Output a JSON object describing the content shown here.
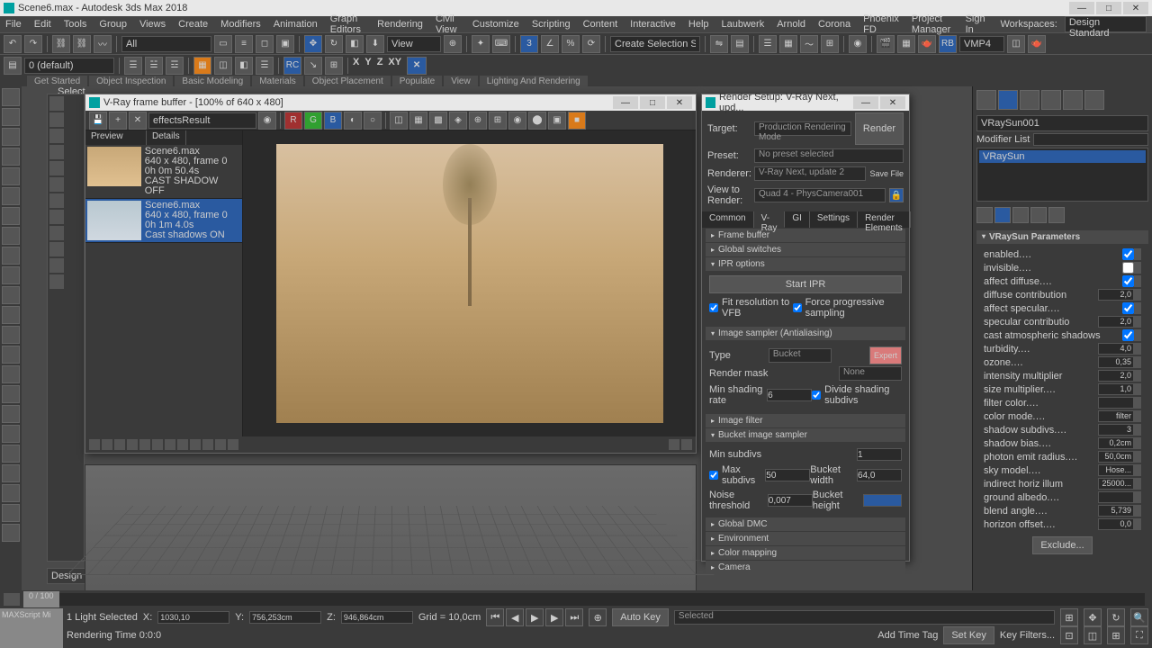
{
  "app": {
    "title": "Scene6.max - Autodesk 3ds Max 2018",
    "signin": "Sign In",
    "workspace_label": "Workspaces:",
    "workspace_value": "Design Standard"
  },
  "menubar": [
    "File",
    "Edit",
    "Tools",
    "Group",
    "Views",
    "Create",
    "Modifiers",
    "Animation",
    "Graph Editors",
    "Rendering",
    "Civil View",
    "Customize",
    "Scripting",
    "Content",
    "Interactive",
    "Help",
    "Laubwerk",
    "Arnold",
    "Corona",
    "Phoenix FD",
    "Project Manager"
  ],
  "ribbon_tabs": [
    "Get Started",
    "Object Inspection",
    "Basic Modeling",
    "Materials",
    "Object Placement",
    "Populate",
    "View",
    "Lighting And Rendering"
  ],
  "toolbar": {
    "dropdown1": "All",
    "ref_coord": "View",
    "selection_set": "Create Selection Se",
    "vmp": "VMP4"
  },
  "layer_bar": {
    "layer": "0 (default)"
  },
  "select_label": "Select",
  "vfb": {
    "title": "V-Ray frame buffer - [100% of 640 x 480]",
    "channel": "effectsResult",
    "history": {
      "col_preview": "Preview",
      "col_details": "Details",
      "items": [
        {
          "file": "Scene6.max",
          "res": "640 x 480, frame 0",
          "time": "0h 0m 50.4s",
          "note": "CAST SHADOW OFF"
        },
        {
          "file": "Scene6.max",
          "res": "640 x 480, frame 0",
          "time": "0h 1m 4.0s",
          "note": "Cast shadows ON"
        }
      ]
    }
  },
  "render_setup": {
    "title": "Render Setup: V-Ray Next, upd...",
    "target_label": "Target:",
    "target_value": "Production Rendering Mode",
    "preset_label": "Preset:",
    "preset_value": "No preset selected",
    "renderer_label": "Renderer:",
    "renderer_value": "V-Ray Next, update 2",
    "view_label": "View to Render:",
    "view_value": "Quad 4 - PhysCamera001",
    "render_btn": "Render",
    "save_btn": "Save File",
    "tabs": [
      "Common",
      "V-Ray",
      "GI",
      "Settings",
      "Render Elements"
    ],
    "rollouts": {
      "frame_buffer": "Frame buffer",
      "global_switches": "Global switches",
      "ipr_options": "IPR options",
      "image_sampler": "Image sampler (Antialiasing)",
      "image_filter": "Image filter",
      "bucket_sampler": "Bucket image sampler",
      "global_dmc": "Global DMC",
      "environment": "Environment",
      "color_mapping": "Color mapping",
      "camera": "Camera"
    },
    "ipr": {
      "start_btn": "Start IPR",
      "fit_res": "Fit resolution to VFB",
      "force_prog": "Force progressive sampling"
    },
    "sampler": {
      "type_label": "Type",
      "type_value": "Bucket",
      "expert_btn": "Expert",
      "mask_label": "Render mask",
      "mask_value": "None",
      "shade_label": "Min shading rate",
      "shade_value": "6",
      "divide": "Divide shading subdivs"
    },
    "bucket": {
      "min_label": "Min subdivs",
      "min_value": "1",
      "max_label": "Max subdivs",
      "max_value": "50",
      "noise_label": "Noise threshold",
      "noise_value": "0,007",
      "bw_label": "Bucket width",
      "bw_value": "64,0",
      "bh_label": "Bucket height"
    }
  },
  "modifier_panel": {
    "object_name": "VRaySun001",
    "modifier_list_label": "Modifier List",
    "stack_item": "VRaySun",
    "rollout_title": "VRaySun Parameters",
    "params": [
      {
        "name": "enabled",
        "val": "",
        "check": true
      },
      {
        "name": "invisible",
        "val": "",
        "check": false
      },
      {
        "name": "affect diffuse",
        "val": "",
        "check": true
      },
      {
        "name": "diffuse contribution",
        "val": "2,0"
      },
      {
        "name": "affect specular",
        "val": "",
        "check": true
      },
      {
        "name": "specular contributio",
        "val": "2,0"
      },
      {
        "name": "cast atmospheric shadows",
        "val": "",
        "check": true
      },
      {
        "name": "turbidity",
        "val": "4,0"
      },
      {
        "name": "ozone",
        "val": "0,35"
      },
      {
        "name": "intensity multiplier",
        "val": "2,0"
      },
      {
        "name": "size multiplier",
        "val": "1,0"
      },
      {
        "name": "filter color",
        "val": ""
      },
      {
        "name": "color mode",
        "val": "filter"
      },
      {
        "name": "shadow subdivs",
        "val": "3"
      },
      {
        "name": "shadow bias",
        "val": "0,2cm"
      },
      {
        "name": "photon emit radius",
        "val": "50,0cm"
      },
      {
        "name": "sky model",
        "val": "Hose..."
      },
      {
        "name": "indirect horiz illum",
        "val": "25000..."
      },
      {
        "name": "ground albedo",
        "val": ""
      },
      {
        "name": "blend angle",
        "val": "5,739"
      },
      {
        "name": "horizon offset",
        "val": "0,0"
      }
    ],
    "exclude_btn": "Exclude..."
  },
  "design_standard_bar": "Design Standard",
  "timeline": {
    "pos_label": "0 / 100"
  },
  "statusbar": {
    "script_box": "MAXScript Mi",
    "selected": "1 Light Selected",
    "rendering": "Rendering Time 0:0:0",
    "x": "1030,10",
    "y": "756,253cm",
    "z": "946,864cm",
    "grid": "Grid = 10,0cm",
    "auto_key": "Auto Key",
    "selected_anim": "Selected",
    "set_key": "Set Key",
    "key_filters": "Key Filters...",
    "add_time_tag": "Add Time Tag"
  }
}
